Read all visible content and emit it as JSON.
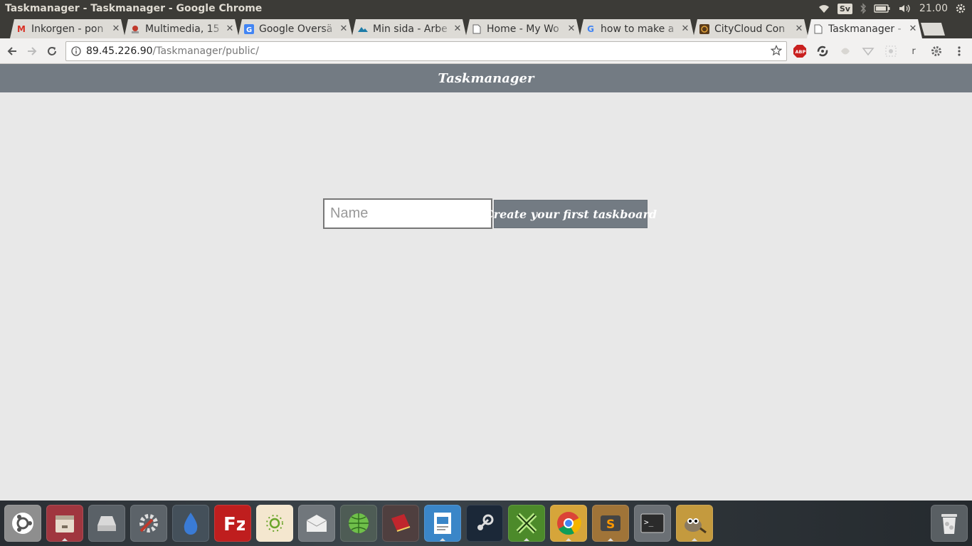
{
  "os_panel": {
    "window_title": "Taskmanager - Taskmanager - Google Chrome",
    "keyboard_layout": "Sv",
    "clock": "21.00"
  },
  "browser": {
    "tabs": [
      {
        "label": "Inkorgen - pon",
        "icon": "gmail-icon",
        "active": false
      },
      {
        "label": "Multimedia, 15",
        "icon": "multimedia-icon",
        "active": false
      },
      {
        "label": "Google Översä",
        "icon": "google-translate-icon",
        "active": false
      },
      {
        "label": "Min sida - Arbe",
        "icon": "arbetsformedlingen-icon",
        "active": false
      },
      {
        "label": "Home - My Wo",
        "icon": "page-icon",
        "active": false
      },
      {
        "label": "how to make a",
        "icon": "google-icon",
        "active": false
      },
      {
        "label": "CityCloud Con",
        "icon": "citycloud-icon",
        "active": false
      },
      {
        "label": "Taskmanager -",
        "icon": "page-icon",
        "active": true
      }
    ],
    "url_host": "89.45.226.90",
    "url_path": "/Taskmanager/public/",
    "extensions": [
      "adblock-icon",
      "sync-icon",
      "pocket-icon",
      "shield-icon",
      "grid-icon",
      "r-icon",
      "settings-icon"
    ],
    "extension_r_label": "r"
  },
  "page": {
    "app_title": "Taskmanager",
    "name_placeholder": "Name",
    "create_button_label": "Create your first taskboard"
  },
  "dock": {
    "apps": [
      "ubuntu-home",
      "files",
      "disks",
      "system-settings",
      "liquid",
      "filezilla",
      "sunflower",
      "mail",
      "network-globe",
      "book",
      "writer",
      "steam",
      "xchat",
      "chrome",
      "sublime-text",
      "terminal",
      "gimp",
      "trash"
    ]
  }
}
